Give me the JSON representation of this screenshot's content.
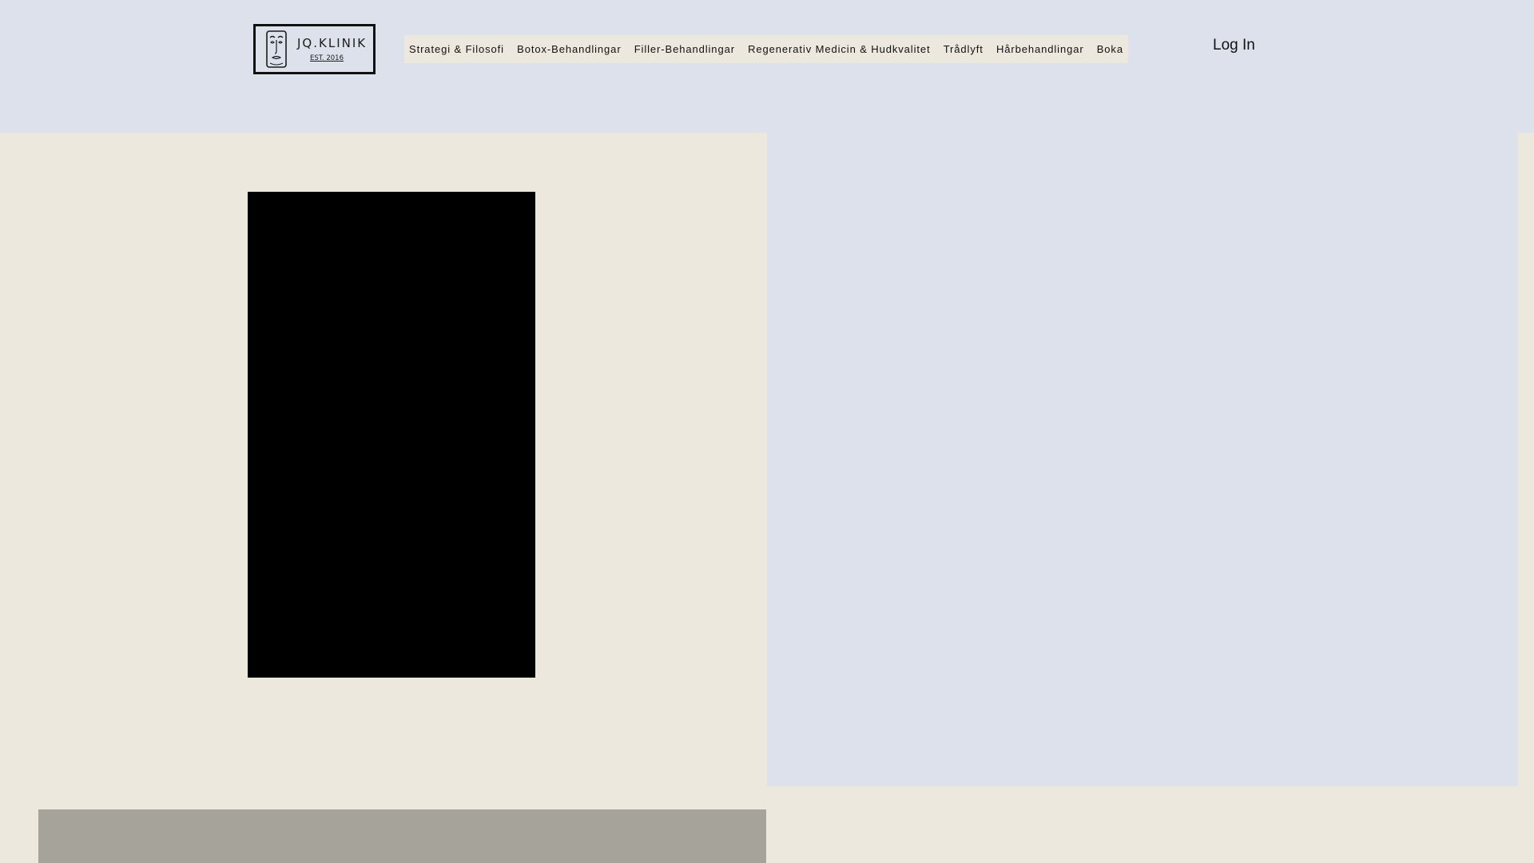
{
  "header": {
    "logo": {
      "name": "JQ.KLINIK",
      "est": "EST. 2016"
    },
    "nav": [
      {
        "label": "Strategi & Filosofi"
      },
      {
        "label": "Botox-Behandlingar"
      },
      {
        "label": "Filler-Behandlingar"
      },
      {
        "label": "Regenerativ Medicin & Hudkvalitet"
      },
      {
        "label": "Trådlyft"
      },
      {
        "label": "Hårbehandlingar"
      },
      {
        "label": "Boka"
      }
    ],
    "login_label": "Log In"
  },
  "colors": {
    "header_bg": "#DDE1EB",
    "page_bg": "#ECE8DD",
    "nav_bg": "#ECE8DD",
    "video_bg": "#000000",
    "strip_bg": "#A6A39A",
    "text": "#111111"
  }
}
